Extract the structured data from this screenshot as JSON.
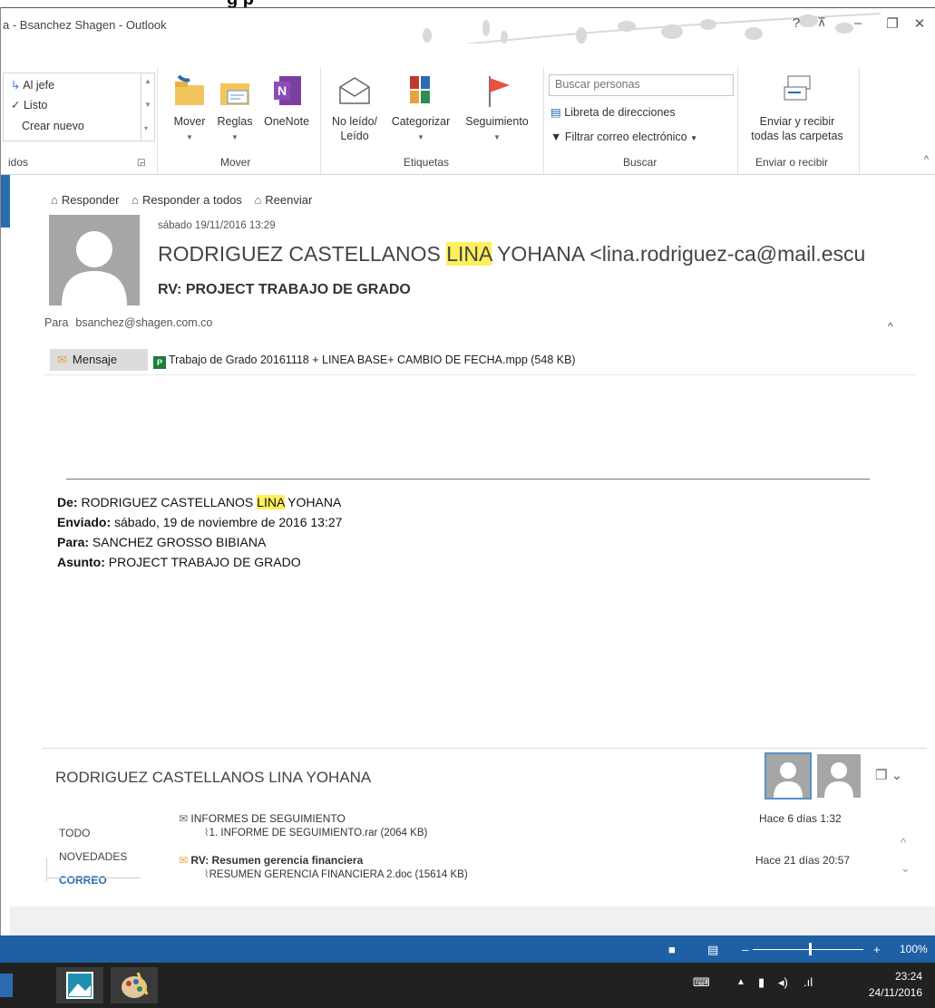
{
  "window": {
    "title": "a - Bsanchez Shagen - Outlook",
    "controls": {
      "help": "?",
      "restore_ribbon": "⊼",
      "minimize": "–",
      "maximize": "❐",
      "close": "✕"
    }
  },
  "top_band": {
    "text": "g   p"
  },
  "ribbon": {
    "quick_steps": [
      "Al jefe",
      "Listo",
      "Crear nuevo"
    ],
    "groups": {
      "quick_steps_label": "idos",
      "move_label": "Mover",
      "tags_label": "Etiquetas",
      "find_label": "Buscar",
      "sendreceive_label": "Enviar o recibir"
    },
    "buttons": {
      "move": "Mover",
      "rules": "Reglas",
      "onenote": "OneNote",
      "unread_line1": "No leído/",
      "unread_line2": "Leído",
      "categorize": "Categorizar",
      "followup": "Seguimiento",
      "sendreceive_line1": "Enviar y recibir",
      "sendreceive_line2": "todas las carpetas"
    },
    "search": {
      "placeholder": "Buscar personas",
      "address_book": "Libreta de direcciones",
      "filter_email": "Filtrar correo electrónico"
    }
  },
  "message": {
    "actions": {
      "reply": "Responder",
      "reply_all": "Responder a todos",
      "forward": "Reenviar"
    },
    "date": "sábado 19/11/2016 13:29",
    "sender_prefix": "RODRIGUEZ CASTELLANOS ",
    "sender_highlight": "LINA",
    "sender_suffix": " YOHANA <lina.rodriguez-ca@mail.escu",
    "subject": "RV: PROJECT TRABAJO DE GRADO",
    "to_label": "Para",
    "to_value": "bsanchez@shagen.com.co",
    "message_tab": "Mensaje",
    "attachment": "Trabajo de Grado 20161118 + LINEA BASE+ CAMBIO DE FECHA.mpp (548 KB)",
    "forward_header": {
      "from_label": "De:",
      "from_prefix": " RODRIGUEZ CASTELLANOS ",
      "from_highlight": "LINA",
      "from_suffix": " YOHANA",
      "sent_label": "Enviado:",
      "sent_value": " sábado, 19 de noviembre de 2016 13:27",
      "to_label": "Para:",
      "to_value": " SANCHEZ GROSSO BIBIANA",
      "subject_label": "Asunto:",
      "subject_value": " PROJECT TRABAJO DE GRADO"
    }
  },
  "people_pane": {
    "name": "RODRIGUEZ CASTELLANOS LINA YOHANA",
    "tabs": [
      "TODO",
      "NOVEDADES",
      "CORREO"
    ],
    "items": [
      {
        "subject": "INFORMES DE SEGUIMIENTO",
        "attachment": "1. INFORME DE SEGUIMIENTO.rar (2064 KB)",
        "date": "Hace 6 días 1:32"
      },
      {
        "subject": "RV: Resumen gerencia financiera",
        "attachment": "RESUMEN GERENCIA FINANCIERA 2.doc (15614 KB)",
        "date": "Hace 21 días 20:57"
      }
    ]
  },
  "statusbar": {
    "zoom": "100%",
    "zoom_level_percent": 100
  },
  "taskbar": {
    "time": "23:24",
    "date": "24/11/2016"
  },
  "colors": {
    "accent": "#1f5fa4",
    "highlight": "#ffef5a",
    "followup_flag": "#e8523f"
  }
}
